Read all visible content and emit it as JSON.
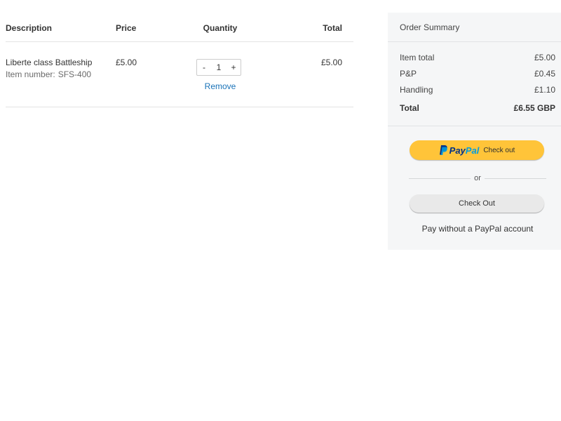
{
  "cart": {
    "headers": {
      "description": "Description",
      "price": "Price",
      "quantity": "Quantity",
      "total": "Total"
    },
    "items": [
      {
        "name": "Liberte class Battleship",
        "item_number_label": "Item number:",
        "item_number": "SFS-400",
        "price": "£5.00",
        "quantity": "1",
        "decrement": "-",
        "increment": "+",
        "remove_label": "Remove",
        "total": "£5.00"
      }
    ]
  },
  "summary": {
    "title": "Order Summary",
    "lines": [
      {
        "label": "Item total",
        "value": "£5.00"
      },
      {
        "label": "P&P",
        "value": "£0.45"
      },
      {
        "label": "Handling",
        "value": "£1.10"
      }
    ],
    "total": {
      "label": "Total",
      "value": "£6.55 GBP"
    },
    "paypal_button": {
      "brand_pay": "Pay",
      "brand_pal": "Pal",
      "label": "Check out",
      "color": "#ffc439"
    },
    "separator": "or",
    "checkout_button": "Check Out",
    "no_account_text": "Pay without a PayPal account"
  },
  "icons": {
    "paypal_logo": "paypal-p-icon"
  },
  "colors": {
    "link": "#1a73b8",
    "paypal_dark_blue": "#003087",
    "paypal_light_blue": "#009cde"
  }
}
